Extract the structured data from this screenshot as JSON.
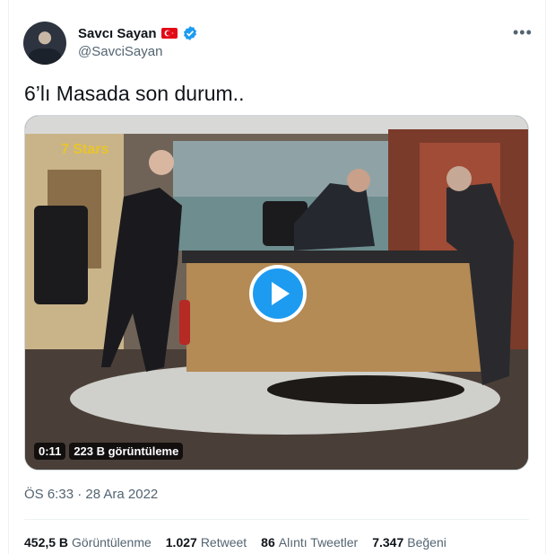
{
  "author": {
    "display_name": "Savcı Sayan",
    "handle": "@SavciSayan",
    "flag_icon": "turkey-flag-icon",
    "verified_icon": "verified-badge-icon"
  },
  "tweet": {
    "text": "6’lı Masada son durum..",
    "more_label": "•••"
  },
  "video": {
    "duration": "0:11",
    "views": "223 B görüntüleme",
    "channel_logo_text": "7 Stars"
  },
  "timestamp": "ÖS 6:33 · 28 Ara 2022",
  "stats": [
    {
      "value": "452,5 B",
      "label": "Görüntülenme"
    },
    {
      "value": "1.027",
      "label": "Retweet"
    },
    {
      "value": "86",
      "label": "Alıntı Tweetler"
    },
    {
      "value": "7.347",
      "label": "Beğeni"
    }
  ],
  "colors": {
    "accent": "#1d9bf0",
    "secondary_text": "#536471",
    "flag_red": "#e30a17"
  }
}
